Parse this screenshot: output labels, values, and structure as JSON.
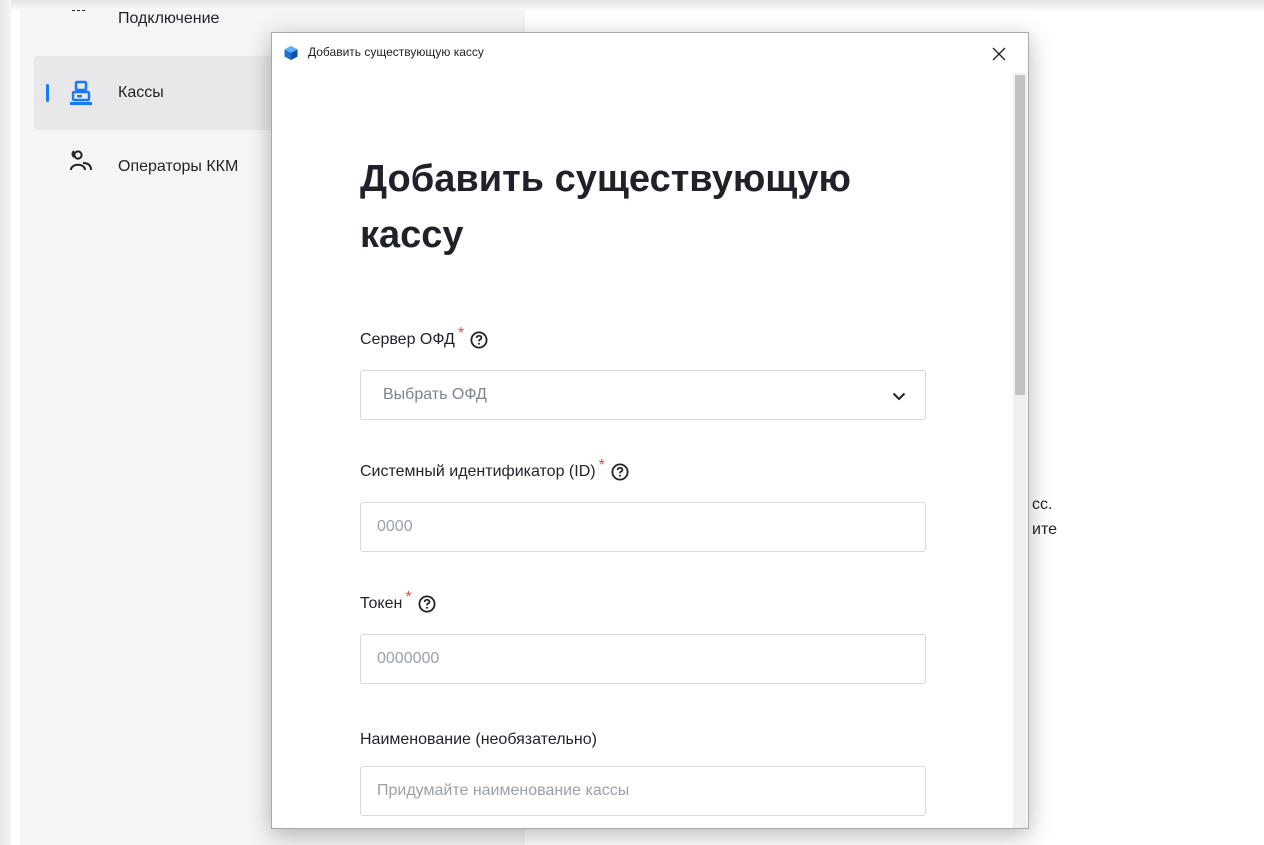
{
  "sidebar": {
    "items": [
      {
        "label": "Подключение",
        "icon": "signal-icon"
      },
      {
        "label": "Кассы",
        "icon": "cash-register-icon",
        "active": true
      },
      {
        "label": "Операторы ККМ",
        "icon": "users-icon"
      }
    ]
  },
  "background": {
    "partial_text_1": "сс.",
    "partial_text_2": "ите"
  },
  "dialog": {
    "window_title": "Добавить существующую кассу",
    "heading": "Добавить существующую кассу",
    "fields": {
      "ofd_server": {
        "label": "Сервер ОФД",
        "required": "*",
        "select_value": "Выбрать ОФД"
      },
      "system_id": {
        "label": "Системный идентификатор (ID)",
        "required": "*",
        "placeholder": "0000"
      },
      "token": {
        "label": "Токен",
        "required": "*",
        "placeholder": "0000000"
      },
      "name": {
        "label": "Наименование (необязательно)",
        "placeholder": "Придумайте наименование кассы"
      }
    }
  },
  "colors": {
    "accent": "#1677ff",
    "required": "#e5484d",
    "text": "#1f2329",
    "placeholder": "#9aa0a8"
  }
}
